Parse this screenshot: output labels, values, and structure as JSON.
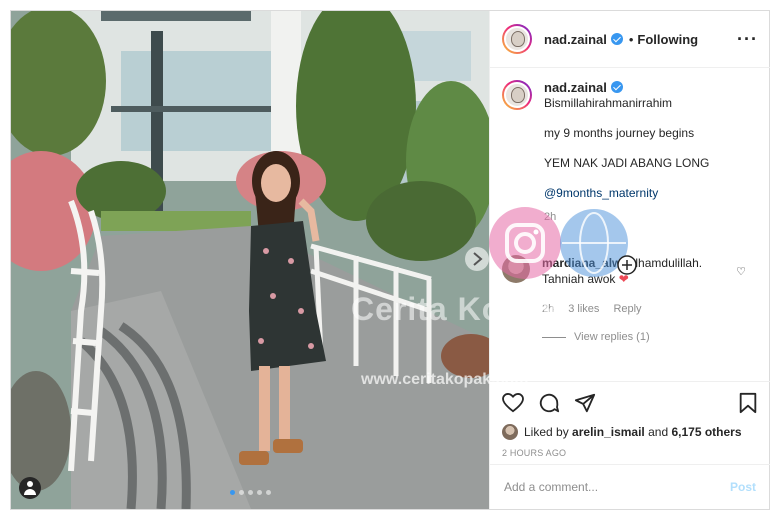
{
  "post": {
    "username": "nad.zainal",
    "follow_status": "Following",
    "separator": "•",
    "more_icon": "more-options-icon",
    "caption": {
      "username": "nad.zainal",
      "lines": [
        "Bismillahirahmanirrahim",
        "my 9 months journey begins",
        "YEM NAK JADI ABANG LONG",
        "@9months_maternity"
      ],
      "time": "2h"
    },
    "comment": {
      "username": "mardiana_alwi",
      "text": "Alhamdulillah. Tahniah awok",
      "emoji": "❤",
      "time": "2h",
      "likes": "3 likes",
      "reply": "Reply"
    },
    "view_replies": "View replies (1)",
    "liked_by": {
      "prefix": "Liked by",
      "user": "arelin_ismail",
      "and": "and",
      "others": "6,175 others"
    },
    "timestamp": "2 HOURS AGO",
    "add_comment": {
      "placeholder": "Add a comment...",
      "post_label": "Post"
    }
  },
  "watermark": {
    "brand": "Cerita Kopak",
    "url": "www.ceritakopak.com"
  },
  "colors": {
    "verified": "#3897f0",
    "link": "#00376b",
    "post_disabled": "#b2dffc",
    "heart": "#ed4956"
  }
}
